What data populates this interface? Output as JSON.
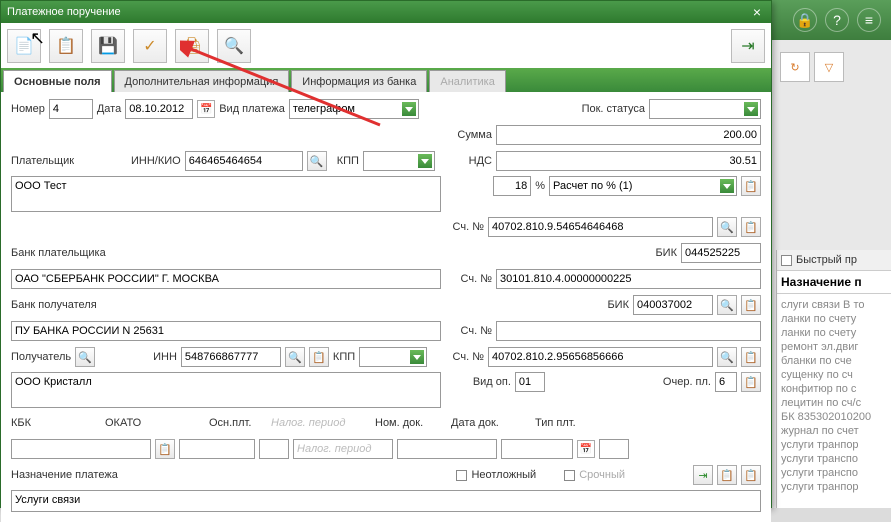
{
  "window": {
    "title": "Платежное поручение"
  },
  "toolbar": {
    "new": "new-doc-icon",
    "copy": "copy-doc-icon",
    "save": "save-icon",
    "check": "check-doc-icon",
    "print": "print-icon",
    "find": "find-icon",
    "exit": "exit-icon"
  },
  "tabs": [
    {
      "id": "main",
      "label": "Основные поля",
      "active": true
    },
    {
      "id": "extra",
      "label": "Дополнительная информация",
      "active": false
    },
    {
      "id": "bank",
      "label": "Информация из банка",
      "active": false
    },
    {
      "id": "analytics",
      "label": "Аналитика",
      "active": false,
      "disabled": true
    }
  ],
  "f": {
    "number_label": "Номер",
    "number": "4",
    "date_label": "Дата",
    "date": "08.10.2012",
    "payment_type_label": "Вид платежа",
    "payment_type": "телеграфом",
    "status_label": "Пок. статуса",
    "status": "",
    "sum_label": "Сумма",
    "sum": "200.00",
    "payer_label": "Плательщик",
    "inn_kio_label": "ИНН/КИО",
    "inn_kio": "646465464654",
    "kpp_label": "КПП",
    "kpp": "",
    "nds_label": "НДС",
    "nds": "30.51",
    "payer_name": "ООО Тест",
    "nds_pct": "18",
    "pct_sym": "%",
    "nds_calc": "Расчет по % (1)",
    "acc_label": "Сч. №",
    "payer_acc": "40702.810.9.54654646468",
    "payer_bank_label": "Банк плательщика",
    "bik_label": "БИК",
    "payer_bik": "044525225",
    "payer_bank_name": "ОАО \"СБЕРБАНК РОССИИ\" Г. МОСКВА",
    "payer_bank_acc": "30101.810.4.00000000225",
    "recv_bank_label": "Банк получателя",
    "recv_bik": "040037002",
    "recv_bank_name": "ПУ БАНКА РОССИИ N 25631",
    "recv_bank_acc": "",
    "recv_label": "Получатель",
    "inn_label": "ИНН",
    "recv_inn": "548766867777",
    "recv_kpp": "",
    "recv_acc": "40702.810.2.95656856666",
    "recv_name": "ООО Кристалл",
    "vid_op_label": "Вид оп.",
    "vid_op": "01",
    "ocher_label": "Очер. пл.",
    "ocher": "6",
    "kbk_label": "КБК",
    "okato_label": "ОКАТО",
    "osn_label": "Осн.плт.",
    "nalog_ph": "Налог. период",
    "nom_dok_label": "Ном. док.",
    "date_dok_label": "Дата док.",
    "tip_plt_label": "Тип плт.",
    "purpose_label": "Назначение платежа",
    "urgent_label": "Неотложный",
    "srochny_label": "Срочный",
    "purpose": "Услуги связи"
  },
  "right": {
    "quick": "Быстрый пр",
    "header": "Назначение п",
    "body": "слуги связи В то\nланки по счету\nланки по счету\nремонт эл.двиг\nбланки по сче\nсущенку по сч\nконфитюр по с\nлецитин по сч/с\nБК 835302010200\nжурнал по счет\nуслуги транпор\nуслуги транспо\nуслуги транспо\nуслуги транпор"
  }
}
